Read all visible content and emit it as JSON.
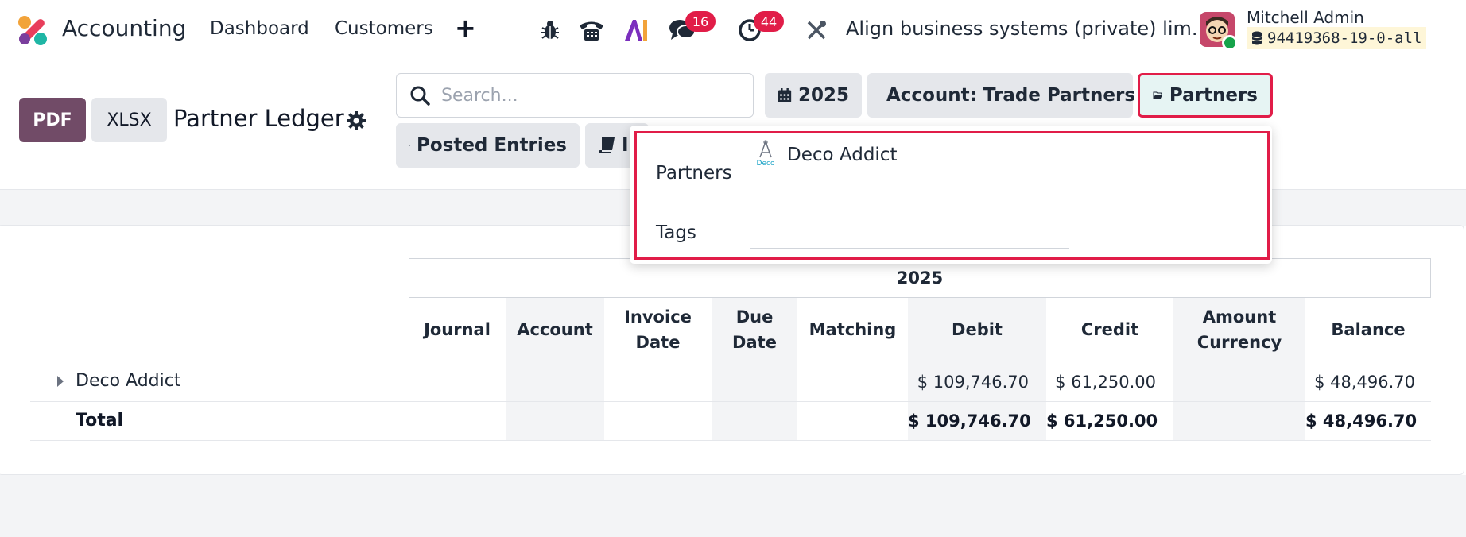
{
  "navbar": {
    "app_name": "Accounting",
    "menu": [
      "Dashboard",
      "Customers"
    ],
    "add_label": "+",
    "chat_count": "16",
    "activity_count": "44",
    "company": "Align business systems (private) lim...",
    "user_name": "Mitchell Admin",
    "database": "94419368-19-0-all"
  },
  "control": {
    "pdf_label": "PDF",
    "xlsx_label": "XLSX",
    "title": "Partner Ledger",
    "search_placeholder": "Search...",
    "filters": {
      "year": "2025",
      "account": "Account: Trade Partners",
      "partners": "Partners",
      "posted": "Posted Entries",
      "journals_partial": "I"
    }
  },
  "dropdown": {
    "partners_label": "Partners",
    "selected_partner": "Deco Addict",
    "partner_logo_text": "Deco",
    "tags_label": "Tags"
  },
  "table": {
    "period": "2025",
    "columns": {
      "journal": "Journal",
      "account": "Account",
      "invoice_date_1": "Invoice",
      "invoice_date_2": "Date",
      "due_date_1": "Due",
      "due_date_2": "Date",
      "matching": "Matching",
      "debit": "Debit",
      "credit": "Credit",
      "amount_currency_1": "Amount",
      "amount_currency_2": "Currency",
      "balance": "Balance"
    },
    "rows": [
      {
        "partner": "Deco Addict",
        "debit": "$ 109,746.70",
        "credit": "$ 61,250.00",
        "balance": "$ 48,496.70"
      }
    ],
    "total": {
      "label": "Total",
      "debit": "$ 109,746.70",
      "credit": "$ 61,250.00",
      "balance": "$ 48,496.70"
    }
  },
  "colors": {
    "brand": "#714b67",
    "highlight": "#e11d48",
    "badge": "#e11d48",
    "online": "#16a34a"
  },
  "icons": [
    "app-logo-icon",
    "bug-icon",
    "phone-icon",
    "ai-icon",
    "chat-icon",
    "clock-icon",
    "tools-icon",
    "database-icon",
    "search-icon",
    "gear-icon",
    "calendar-icon",
    "user-icon",
    "folder-open-icon",
    "sliders-icon",
    "book-icon",
    "caret-right-icon"
  ]
}
